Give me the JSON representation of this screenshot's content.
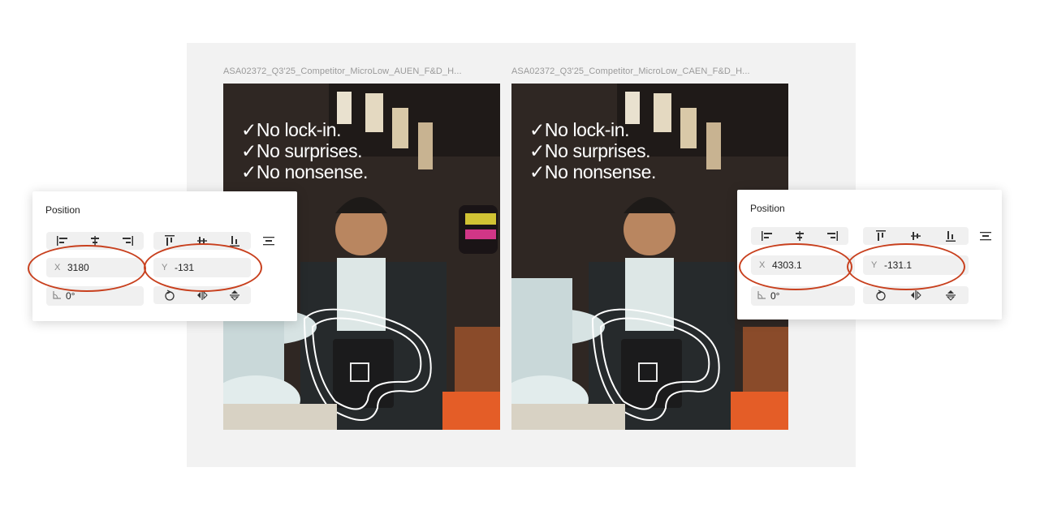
{
  "frames": [
    {
      "label": "ASA02372_Q3'25_Competitor_MicroLow_AUEN_F&D_H...",
      "headline": [
        "✓No lock-in.",
        "✓No surprises.",
        "✓No nonsense."
      ]
    },
    {
      "label": "ASA02372_Q3'25_Competitor_MicroLow_CAEN_F&D_H...",
      "headline": [
        "✓No lock-in.",
        "✓No surprises.",
        "✓No nonsense."
      ]
    }
  ],
  "panels": [
    {
      "title": "Position",
      "x_label": "X",
      "x_value": "3180",
      "y_label": "Y",
      "y_value": "-131",
      "rotation_value": "0°"
    },
    {
      "title": "Position",
      "x_label": "X",
      "x_value": "4303.1",
      "y_label": "Y",
      "y_value": "-131.1",
      "rotation_value": "0°"
    }
  ],
  "colors": {
    "highlight": "#c8401e",
    "canvas": "#f2f2f2"
  },
  "icons": {
    "align": [
      "align-left-icon",
      "align-center-h-icon",
      "align-right-icon",
      "align-top-icon",
      "align-center-v-icon",
      "align-bottom-icon",
      "distribute-icon"
    ],
    "transform": [
      "rotation-angle-icon",
      "rotate-icon",
      "flip-horizontal-icon",
      "flip-vertical-icon"
    ]
  }
}
